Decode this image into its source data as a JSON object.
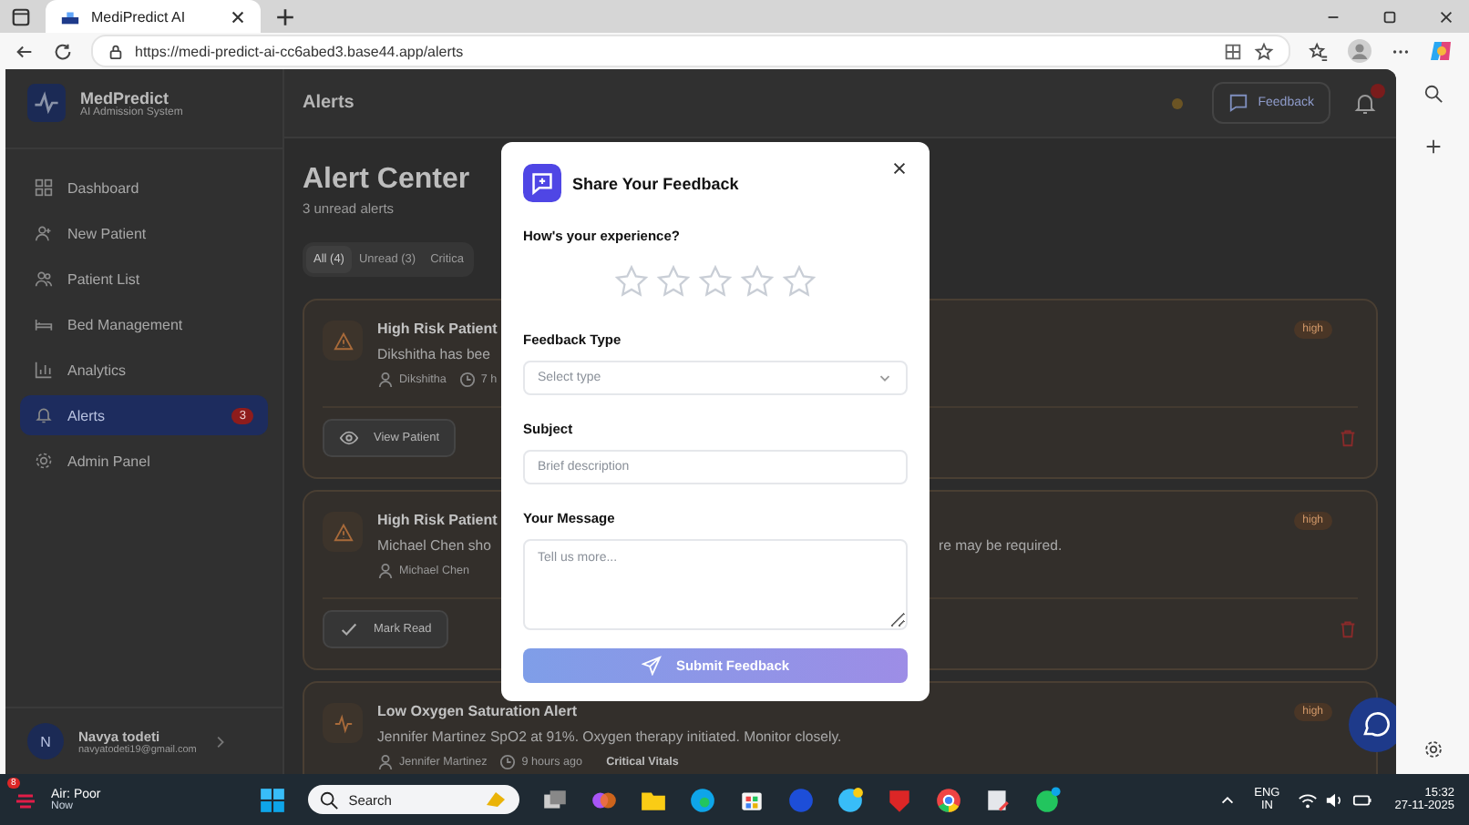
{
  "browser": {
    "tab_title": "MediPredict AI",
    "url": "https://medi-predict-ai-cc6abed3.base44.app/alerts"
  },
  "sidebar": {
    "brand": "MedPredict",
    "subtitle": "AI Admission System",
    "items": [
      {
        "label": "Dashboard",
        "selected": false
      },
      {
        "label": "New Patient",
        "selected": false
      },
      {
        "label": "Patient List",
        "selected": false
      },
      {
        "label": "Bed Management",
        "selected": false
      },
      {
        "label": "Analytics",
        "selected": false
      },
      {
        "label": "Alerts",
        "selected": true,
        "badge": "3"
      },
      {
        "label": "Admin Panel",
        "selected": false
      }
    ],
    "user": {
      "initial": "N",
      "name": "Navya todeti",
      "email": "navyatodeti19@gmail.com"
    }
  },
  "header": {
    "title": "Alerts",
    "feedback_button": "Feedback"
  },
  "page": {
    "title": "Alert Center",
    "subtitle": "3 unread alerts",
    "tabs": [
      {
        "label": "All (4)",
        "selected": true
      },
      {
        "label": "Unread (3)",
        "selected": false
      },
      {
        "label": "Critica",
        "selected": false
      }
    ],
    "alerts": [
      {
        "kind": "warning",
        "title": "High Risk Patient",
        "message_left": "Dikshitha has bee",
        "patient": "Dikshitha",
        "time": "7 h",
        "badge": "high",
        "action": {
          "kind": "view",
          "label": "View Patient"
        }
      },
      {
        "kind": "warning",
        "title": "High Risk Patient",
        "message_left": "Michael Chen sho",
        "message_right": "re may be required.",
        "patient": "Michael Chen",
        "badge": "high",
        "action": {
          "kind": "read",
          "label": "Mark Read"
        }
      },
      {
        "kind": "vitals",
        "title": "Low Oxygen Saturation Alert",
        "message_left": "Jennifer Martinez SpO2 at 91%. Oxygen therapy initiated. Monitor closely.",
        "patient": "Jennifer Martinez",
        "time": "9 hours ago",
        "category": "Critical Vitals",
        "badge": "high"
      }
    ]
  },
  "modal": {
    "title": "Share Your Feedback",
    "question": "How's your experience?",
    "stars": 0,
    "fields": [
      {
        "kind": "select",
        "label": "Feedback Type",
        "placeholder": "Select type"
      },
      {
        "kind": "input",
        "label": "Subject",
        "placeholder": "Brief description"
      },
      {
        "kind": "textarea",
        "label": "Your Message",
        "placeholder": "Tell us more..."
      }
    ],
    "submit": {
      "label": "Submit Feedback",
      "disabled": true
    }
  },
  "taskbar": {
    "weather": "Air: Poor",
    "weather_sub": "Now",
    "weather_badge": "8",
    "search": "Search",
    "lang": "ENG",
    "region": "IN",
    "time": "15:32",
    "date": "27-11-2025"
  }
}
